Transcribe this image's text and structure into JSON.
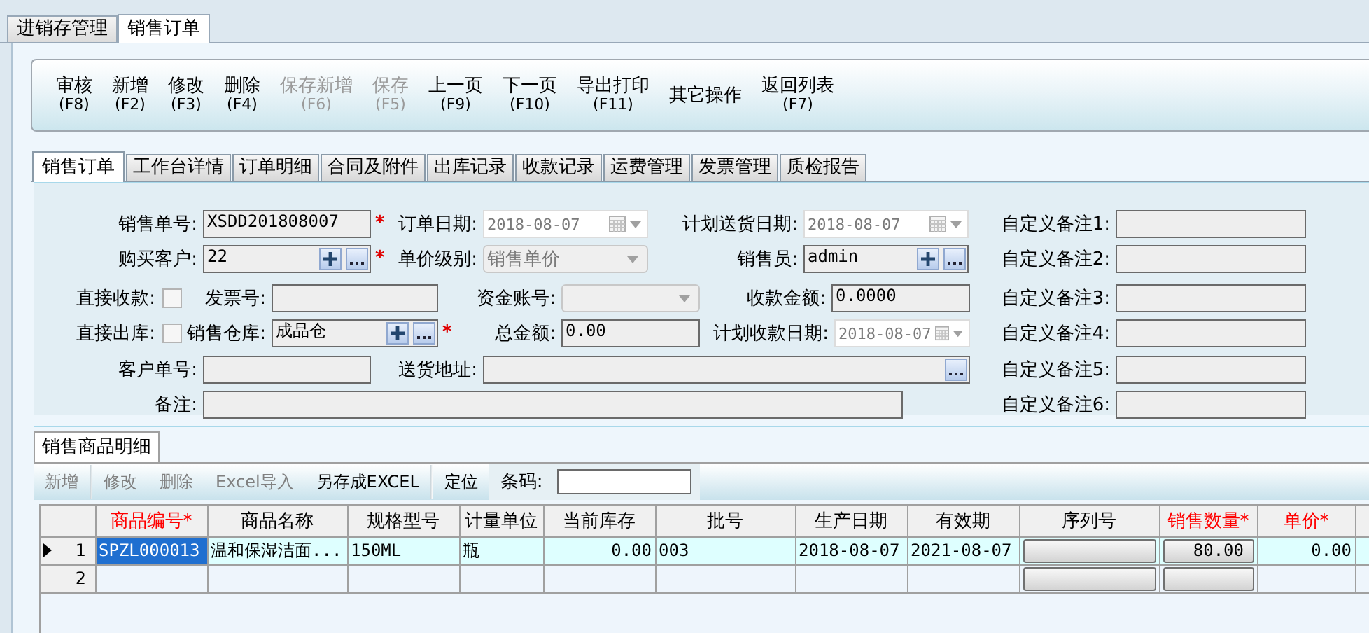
{
  "outer_tabs": [
    {
      "label": "进销存管理",
      "selected": false
    },
    {
      "label": "销售订单",
      "selected": true
    }
  ],
  "toolbar": [
    {
      "label": "审核",
      "key": "(F8)",
      "disabled": false
    },
    {
      "label": "新增",
      "key": "(F2)",
      "disabled": false
    },
    {
      "label": "修改",
      "key": "(F3)",
      "disabled": false
    },
    {
      "label": "删除",
      "key": "(F4)",
      "disabled": false
    },
    {
      "label": "保存新增",
      "key": "(F6)",
      "disabled": true
    },
    {
      "label": "保存",
      "key": "(F5)",
      "disabled": true
    },
    {
      "label": "上一页",
      "key": "(F9)",
      "disabled": false
    },
    {
      "label": "下一页",
      "key": "(F10)",
      "disabled": false
    },
    {
      "label": "导出打印",
      "key": "(F11)",
      "disabled": false
    },
    {
      "label": "其它操作",
      "disabled": false
    },
    {
      "label": "返回列表",
      "key": "(F7)",
      "disabled": false
    }
  ],
  "form_tabs": [
    {
      "label": "销售订单",
      "selected": true
    },
    {
      "label": "工作台详情",
      "selected": false
    },
    {
      "label": "订单明细",
      "selected": false
    },
    {
      "label": "合同及附件",
      "selected": false
    },
    {
      "label": "出库记录",
      "selected": false
    },
    {
      "label": "收款记录",
      "selected": false
    },
    {
      "label": "运费管理",
      "selected": false
    },
    {
      "label": "发票管理",
      "selected": false
    },
    {
      "label": "质检报告",
      "selected": false
    }
  ],
  "form": {
    "rows": [
      [
        {
          "label": "销售单号:",
          "kind": "text",
          "value": "XSDD201808007",
          "required_mark": "*"
        },
        {
          "label": "订单日期:",
          "kind": "date",
          "value": "2018-08-07",
          "disabled": true
        },
        {
          "label": "计划送货日期:",
          "kind": "date",
          "value": "2018-08-07",
          "disabled": true
        }
      ],
      [
        {
          "label": "购买客户:",
          "kind": "lookup",
          "value": "22",
          "required_mark": "*"
        },
        {
          "label": "单价级别:",
          "kind": "select",
          "value": "销售单价",
          "disabled": true
        },
        {
          "label": "销售员:",
          "kind": "lookup",
          "value": "admin"
        }
      ],
      [
        {
          "label": "直接收款:",
          "kind": "check",
          "checked": false
        },
        {
          "label": "发票号:",
          "kind": "text"
        },
        {
          "label": "资金账号:",
          "kind": "select",
          "disabled": true
        },
        {
          "label": "收款金额:",
          "kind": "text",
          "value": "0.0000"
        }
      ],
      [
        {
          "label": "直接出库:",
          "kind": "check",
          "checked": false
        },
        {
          "label": "销售仓库:",
          "kind": "lookup",
          "value": "成品仓",
          "required_mark": "*"
        },
        {
          "label": "总金额:",
          "kind": "text",
          "value": "0.00"
        },
        {
          "label": "计划收款日期:",
          "kind": "date",
          "value": "2018-08-07",
          "disabled": true
        }
      ],
      [
        {
          "label": "客户单号:",
          "kind": "text"
        },
        {
          "label": "送货地址:",
          "kind": "picker"
        }
      ],
      [
        {
          "label": "备注:",
          "kind": "text"
        }
      ]
    ],
    "custom_notes": [
      {
        "label": "自定义备注1:"
      },
      {
        "label": "自定义备注2:"
      },
      {
        "label": "自定义备注3:"
      },
      {
        "label": "自定义备注4:"
      },
      {
        "label": "自定义备注5:"
      },
      {
        "label": "自定义备注6:"
      }
    ]
  },
  "detail_tab": {
    "label": "销售商品明细"
  },
  "detail_toolbar": {
    "buttons": [
      {
        "label": "新增",
        "disabled": true
      },
      {
        "label": "修改",
        "disabled": true
      },
      {
        "label": "删除",
        "disabled": true
      },
      {
        "label": "Excel导入",
        "disabled": true
      },
      {
        "label": "另存成EXCEL",
        "disabled": false
      },
      {
        "label": "定位",
        "disabled": false
      }
    ],
    "barcode": {
      "label": "条码:"
    }
  },
  "grid": {
    "columns": [
      {
        "label": "商品编号*",
        "required": true
      },
      {
        "label": "商品名称",
        "required": false
      },
      {
        "label": "规格型号",
        "required": false
      },
      {
        "label": "计量单位",
        "required": false
      },
      {
        "label": "当前库存",
        "required": false
      },
      {
        "label": "批号",
        "required": false
      },
      {
        "label": "生产日期",
        "required": false
      },
      {
        "label": "有效期",
        "required": false
      },
      {
        "label": "序列号",
        "required": false
      },
      {
        "label": "销售数量*",
        "required": true
      },
      {
        "label": "单价*",
        "required": true
      }
    ],
    "rows": [
      {
        "number": "1",
        "current": true,
        "cells": [
          {
            "kind": "text",
            "value": "SPZL000013",
            "selected": true
          },
          {
            "kind": "text",
            "value": "温和保湿洁面...",
            "selected": false
          },
          {
            "kind": "text",
            "value": "150ML",
            "selected": false
          },
          {
            "kind": "text",
            "value": "瓶",
            "selected": false
          },
          {
            "kind": "text",
            "value": "0.00",
            "selected": false
          },
          {
            "kind": "text",
            "value": "003",
            "selected": false
          },
          {
            "kind": "text",
            "value": "2018-08-07",
            "selected": false
          },
          {
            "kind": "text",
            "value": "2021-08-07",
            "selected": false
          },
          {
            "kind": "button",
            "selected": false
          },
          {
            "kind": "button",
            "value": "80.00",
            "selected": false
          },
          {
            "kind": "text",
            "value": "0.00",
            "selected": false
          }
        ]
      },
      {
        "number": "2",
        "current": false,
        "cells": [
          {
            "kind": "text",
            "selected": false
          },
          {
            "kind": "text",
            "selected": false
          },
          {
            "kind": "text",
            "selected": false
          },
          {
            "kind": "text",
            "selected": false
          },
          {
            "kind": "text",
            "selected": false
          },
          {
            "kind": "text",
            "selected": false
          },
          {
            "kind": "text",
            "selected": false
          },
          {
            "kind": "text",
            "selected": false
          },
          {
            "kind": "button",
            "selected": false
          },
          {
            "kind": "button",
            "selected": false
          },
          {
            "kind": "text",
            "selected": false
          }
        ]
      }
    ]
  }
}
